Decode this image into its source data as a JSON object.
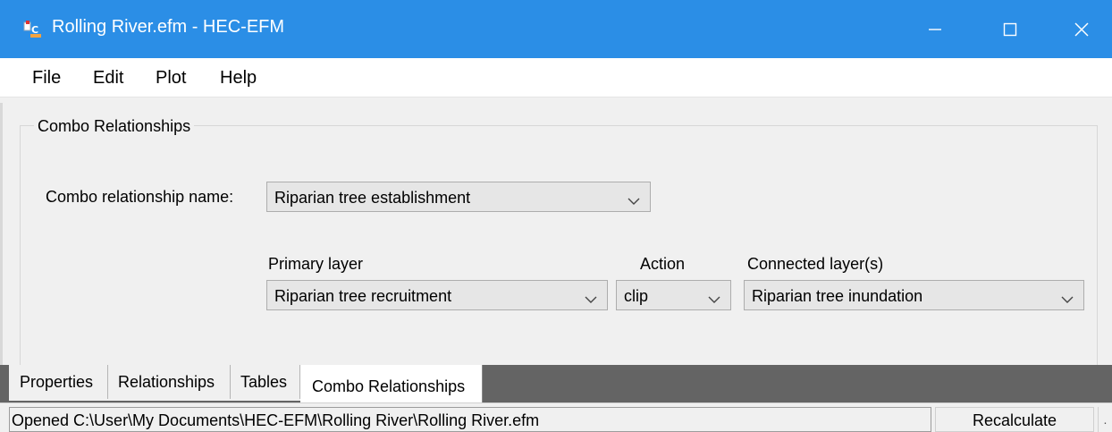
{
  "window": {
    "title": "Rolling River.efm - HEC-EFM",
    "icon": "hec-efm-app-icon",
    "titlebar_color": "#2b8ee6"
  },
  "menu": {
    "items": [
      {
        "label": "File"
      },
      {
        "label": "Edit"
      },
      {
        "label": "Plot"
      },
      {
        "label": "Help"
      }
    ]
  },
  "group": {
    "legend": "Combo Relationships"
  },
  "form": {
    "combo_name_label": "Combo relationship name:",
    "combo_name_value": "Riparian tree establishment",
    "primary_label": "Primary layer",
    "primary_value": "Riparian tree recruitment",
    "action_label": "Action",
    "action_value": "clip",
    "connected_label": "Connected layer(s)",
    "connected_value": "Riparian tree inundation"
  },
  "tabs": [
    {
      "label": "Properties"
    },
    {
      "label": "Relationships"
    },
    {
      "label": "Tables"
    },
    {
      "label": "Combo Relationships",
      "active": true
    }
  ],
  "status": {
    "message": "Opened C:\\User\\My Documents\\HEC-EFM\\Rolling River\\Rolling River.efm",
    "button": "Recalculate",
    "grip": "."
  }
}
